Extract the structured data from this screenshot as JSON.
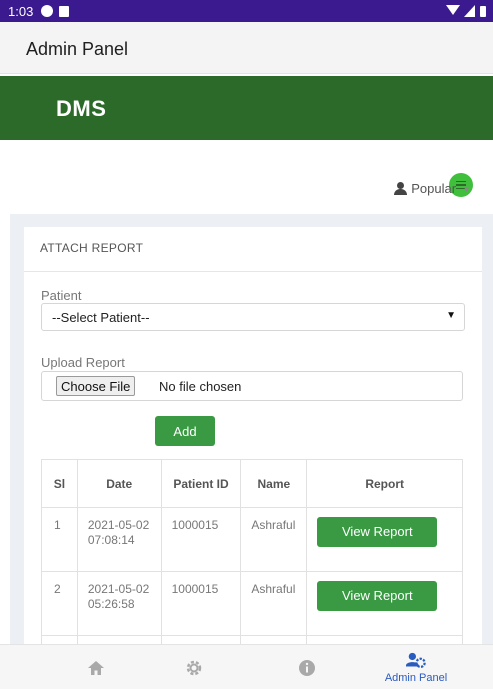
{
  "status_bar": {
    "time": "1:03"
  },
  "app_bar": {
    "title": "Admin Panel"
  },
  "brand_bar": {
    "brand": "DMS"
  },
  "user_menu": {
    "name": "Popular"
  },
  "attach_report": {
    "title": "ATTACH REPORT",
    "patient_label": "Patient",
    "patient_select_value": "--Select Patient--",
    "upload_label": "Upload Report",
    "choose_file_label": "Choose File",
    "no_file_text": "No file chosen",
    "add_label": "Add"
  },
  "table": {
    "headers": [
      "Sl",
      "Date",
      "Patient ID",
      "Name",
      "Report"
    ],
    "rows": [
      {
        "sl": "1",
        "date": "2021-05-02 07:08:14",
        "patient_id": "1000015",
        "name": "Ashraful",
        "action": "View Report"
      },
      {
        "sl": "2",
        "date": "2021-05-02 05:26:58",
        "patient_id": "1000015",
        "name": "Ashraful",
        "action": "View Report"
      }
    ]
  },
  "bottom_nav": {
    "items": [
      {
        "icon": "home-icon",
        "label": ""
      },
      {
        "icon": "gear-icon",
        "label": ""
      },
      {
        "icon": "info-icon",
        "label": ""
      },
      {
        "icon": "admin-icon",
        "label": "Admin Panel",
        "active": true
      }
    ]
  },
  "colors": {
    "status_bar": "#3b1a8f",
    "brand_green": "#2c6a2a",
    "button_green": "#3a9a43",
    "active_nav": "#2a5bbf"
  }
}
